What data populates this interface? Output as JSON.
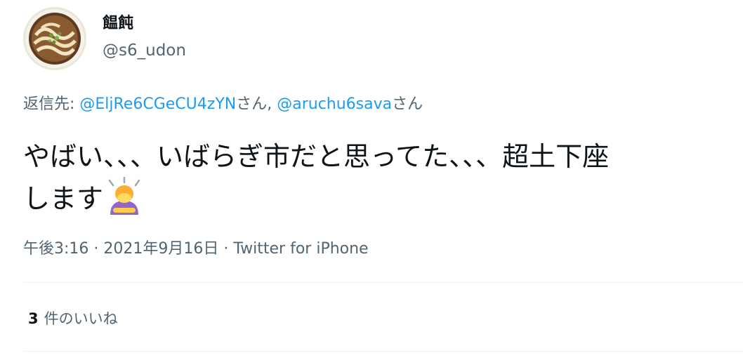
{
  "user": {
    "display_name": "饂飩",
    "handle": "@s6_udon",
    "avatar_icon": "udon-bowl-avatar-icon"
  },
  "reply": {
    "prefix": "返信先: ",
    "mention1": "@EljRe6CGeCU4zYN",
    "suffix1": "さん",
    "separator": ", ",
    "mention2": "@aruchu6sava",
    "suffix2": "さん"
  },
  "tweet": {
    "line1": "やばい、、、いばらぎ市だと思ってた、、、超土下座",
    "line2": "します",
    "emoji": "person-bowing-emoji"
  },
  "meta": {
    "time": "午後3:16",
    "sep1": " · ",
    "date": "2021年9月16日",
    "sep2": " · ",
    "source": "Twitter for iPhone"
  },
  "likes": {
    "count": "3",
    "label": "件のいいね"
  },
  "colors": {
    "text_primary": "#0f1419",
    "text_secondary": "#536471",
    "link": "#1d9bf0",
    "divider": "#eff3f4"
  }
}
